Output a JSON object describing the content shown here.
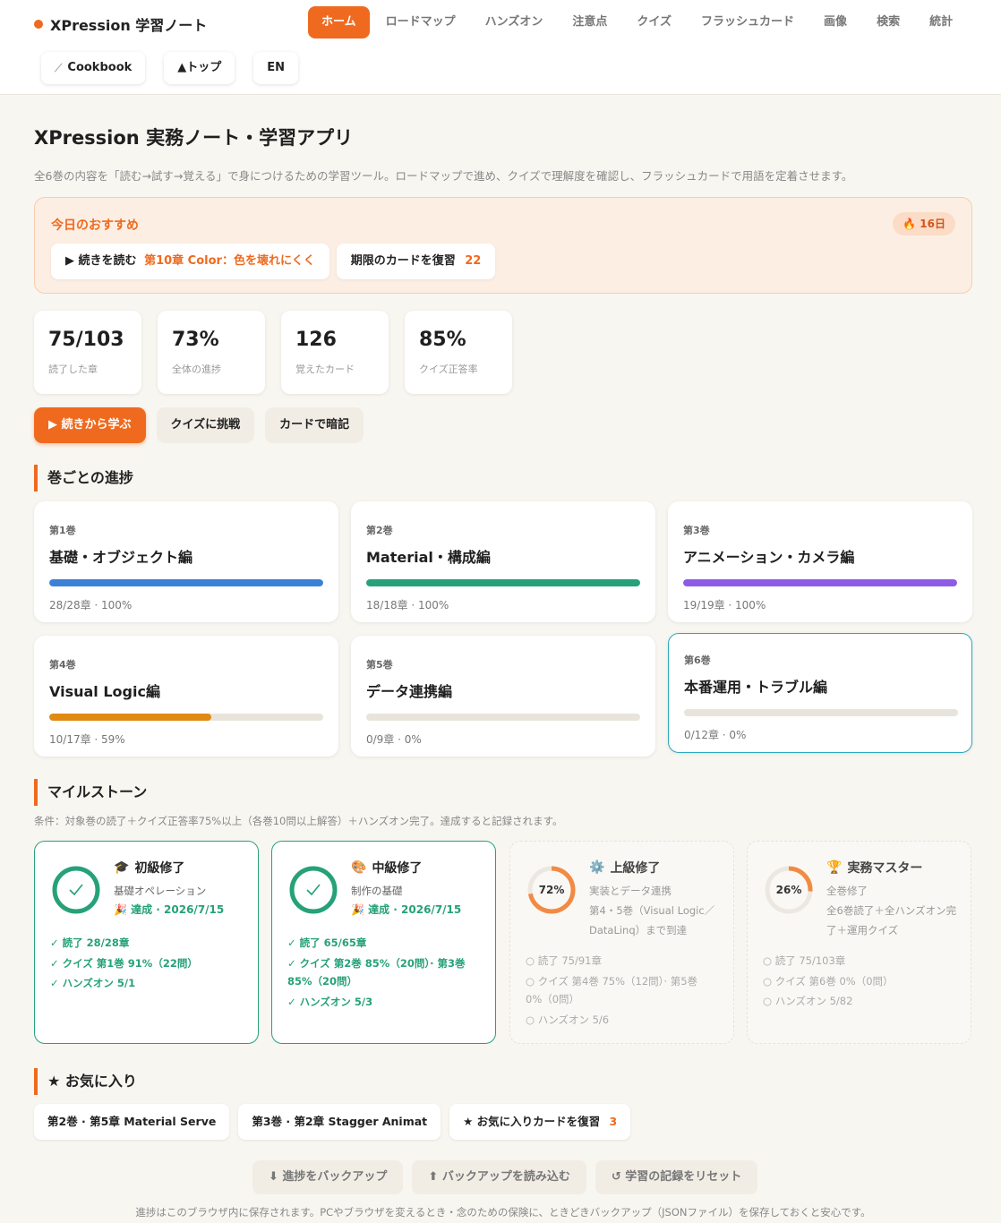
{
  "header": {
    "brand": "XPression 学習ノート",
    "nav": [
      "ホーム",
      "ロードマップ",
      "ハンズオン",
      "注意点",
      "クイズ",
      "フラッシュカード",
      "画像",
      "検索",
      "統計"
    ],
    "subnav": {
      "cookbook": "Cookbook",
      "top": "▲トップ",
      "lang": "EN"
    }
  },
  "page": {
    "title": "XPression 実務ノート・学習アプリ",
    "desc": "全6巻の内容を「読む→試す→覚える」で身につけるための学習ツール。ロードマップで進め、クイズで理解度を確認し、フラッシュカードで用語を定着させます。"
  },
  "recommend": {
    "title": "今日のおすすめ",
    "streak": "16日",
    "continue_prefix": "▶ 続きを読む",
    "continue_chapter": "第10章 Color：色を壊れにくく",
    "review_label": "期限のカードを復習",
    "review_count": "22"
  },
  "stats": [
    {
      "value": "75/103",
      "label": "読了した章"
    },
    {
      "value": "73%",
      "label": "全体の進捗"
    },
    {
      "value": "126",
      "label": "覚えたカード"
    },
    {
      "value": "85%",
      "label": "クイズ正答率"
    }
  ],
  "actions": {
    "continue": "▶ 続きから学ぶ",
    "quiz": "クイズに挑戦",
    "cards": "カードで暗記"
  },
  "volumes_section": {
    "title": "巻ごとの進捗",
    "items": [
      {
        "num": "第1巻",
        "title": "基礎・オブジェクト編",
        "meta": "28/28章 · 100%",
        "progress": 1.0,
        "color": "#3b82d6"
      },
      {
        "num": "第2巻",
        "title": "Material・構成編",
        "meta": "18/18章 · 100%",
        "progress": 1.0,
        "color": "#26a17a"
      },
      {
        "num": "第3巻",
        "title": "アニメーション・カメラ編",
        "meta": "19/19章 · 100%",
        "progress": 1.0,
        "color": "#8e5ae8"
      },
      {
        "num": "第4巻",
        "title": "Visual Logic編",
        "meta": "10/17章 · 59%",
        "progress": 0.59,
        "color": "#e08a12"
      },
      {
        "num": "第5巻",
        "title": "データ連携編",
        "meta": "0/9章 · 0%",
        "progress": 0,
        "color": "#e8e4dc"
      },
      {
        "num": "第6巻",
        "title": "本番運用・トラブル編",
        "meta": "0/12章 · 0%",
        "progress": 0,
        "color": "#e8e4dc"
      }
    ]
  },
  "milestones": {
    "title": "マイルストーン",
    "condition": "条件：対象巻の読了＋クイズ正答率75%以上（各巻10問以上解答）＋ハンズオン完了。達成すると記録されます。",
    "items": [
      {
        "icon": "🎓",
        "title": "初級修了",
        "sub": "基礎オペレーション",
        "achieved": "🎉 達成 · 2026/7/15",
        "list": [
          "✓ 読了 28/28章",
          "✓ クイズ 第1巻 91%（22問）",
          "✓ ハンズオン 5/1"
        ]
      },
      {
        "icon": "🎨",
        "title": "中級修了",
        "sub": "制作の基礎",
        "achieved": "🎉 達成 · 2026/7/15",
        "list": [
          "✓ 読了 65/65章",
          "✓ クイズ 第2巻 85%（20問）· 第3巻 85%（20問）",
          "✓ ハンズオン 5/3"
        ]
      },
      {
        "icon": "⚙️",
        "title": "上級修了",
        "sub": "実装とデータ連携",
        "sub2": "第4・5巻（Visual Logic／DataLinq）まで到達",
        "ring": "72%",
        "list": [
          "○ 読了 75/91章",
          "○ クイズ 第4巻 75%（12問）· 第5巻 0%（0問）",
          "○ ハンズオン 5/6"
        ]
      },
      {
        "icon": "🏆",
        "title": "実務マスター",
        "sub": "全巻修了",
        "sub2": "全6巻読了＋全ハンズオン完了＋運用クイズ",
        "ring": "26%",
        "list": [
          "○ 読了 75/103章",
          "○ クイズ 第6巻 0%（0問）",
          "○ ハンズオン 5/82"
        ]
      }
    ]
  },
  "favorites": {
    "title": "★ お気に入り",
    "items": [
      "第2巻 · 第5章 Material Serve",
      "第3巻 · 第2章 Stagger Animat"
    ],
    "review_label": "★ お気に入りカードを復習",
    "review_count": "3"
  },
  "backup": {
    "backup": "⬇ 進捗をバックアップ",
    "restore": "⬆ バックアップを読み込む",
    "reset": "↺ 学習の記録をリセット",
    "note": "進捗はこのブラウザ内に保存されます。PCやブラウザを変えるとき・念のための保険に、ときどきバックアップ（JSONファイル）を保存しておくと安心です。"
  }
}
